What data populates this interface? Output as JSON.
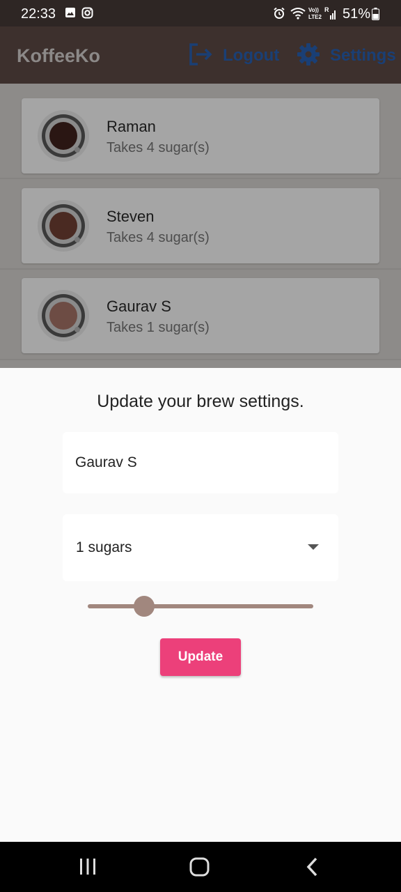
{
  "status_bar": {
    "time": "22:33",
    "battery": "51%",
    "icons": [
      "gallery-icon",
      "instagram-icon",
      "alarm-icon",
      "wifi-icon",
      "volte-icon",
      "signal-icon",
      "battery-icon"
    ]
  },
  "app_bar": {
    "title": "KoffeeKo",
    "logout_label": "Logout",
    "settings_label": "Settings",
    "action_color": "#1a3f75"
  },
  "brew_list": [
    {
      "name": "Raman",
      "subtitle": "Takes 4 sugar(s)",
      "coffee_color": "#2a1613"
    },
    {
      "name": "Steven",
      "subtitle": "Takes 4 sugar(s)",
      "coffee_color": "#4a2a22"
    },
    {
      "name": "Gaurav S",
      "subtitle": "Takes 1 sugar(s)",
      "coffee_color": "#6d4c44"
    }
  ],
  "sheet": {
    "title": "Update your brew settings.",
    "name_value": "Gaurav S",
    "sugars_selected": "1 sugars",
    "strength_value": 0.25,
    "update_label": "Update",
    "accent_color": "#ec407a",
    "slider_color": "#a1877e"
  },
  "nav_bar": {
    "icons": [
      "recents-icon",
      "home-icon",
      "back-icon"
    ]
  }
}
